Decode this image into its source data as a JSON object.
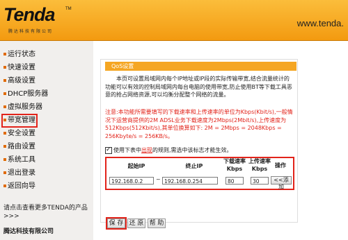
{
  "header": {
    "logo_text": "Tenda",
    "logo_tm": "TM",
    "logo_tagline": "腾达科技有限公司",
    "site_url": "www.tenda.",
    "brand_color": "#f5a623"
  },
  "sidebar": {
    "items": [
      {
        "label": "运行状态"
      },
      {
        "label": "快速设置"
      },
      {
        "label": "高级设置"
      },
      {
        "label": "DHCP服务器"
      },
      {
        "label": "虚拟服务器"
      },
      {
        "label": "带宽管理",
        "active": true
      },
      {
        "label": "安全设置"
      },
      {
        "label": "路由设置"
      },
      {
        "label": "系统工具"
      },
      {
        "label": "退出登录"
      },
      {
        "label": "返回向导"
      }
    ],
    "footer_text": "请点击查看更多TENDA的产品>>>",
    "company": "腾达科技有限公司"
  },
  "panel": {
    "title": "QoS设置",
    "description": "本页可设置局域网内每个IP地址或IP段的实际传输带宽,结合流量统计的功能可以有效的控制局域网内每台电脑的使用带宽,防止使用BT等下载工具恶意的抢占网络资源,可以均衡分配整个网络的流量。",
    "note": "注意:本功能所需要填写的下载速率和上传速率的单位为Kbps(Kbit/s),一般情况下运营商提供的2M ADSL业务下载速度为2Mbps(2Mbit/s),上传速度为512Kbps(512Kbit/s),其单位换算如下: 2M = 2Mbps = 2048Kbps = 256Kbyte/s = 256KB/s。",
    "agree_prefix": "使用下表中",
    "agree_link": "出现",
    "agree_suffix": "的规则,需选中该标志才能生效。"
  },
  "rule_table": {
    "headers": {
      "start_ip": "起始IP",
      "end_ip": "终止IP",
      "download": "下载速率",
      "download_unit": "Kbps",
      "upload": "上传速率",
      "upload_unit": "Kbps",
      "action": "操作"
    },
    "row": {
      "start_ip": "192.168.0.2",
      "separator": "~",
      "end_ip": "192.168.0.254",
      "download": "80",
      "upload": "30",
      "add_label": "<<添加"
    }
  },
  "buttons": {
    "save": "保 存",
    "restore": "还 原",
    "help": "帮 助"
  }
}
